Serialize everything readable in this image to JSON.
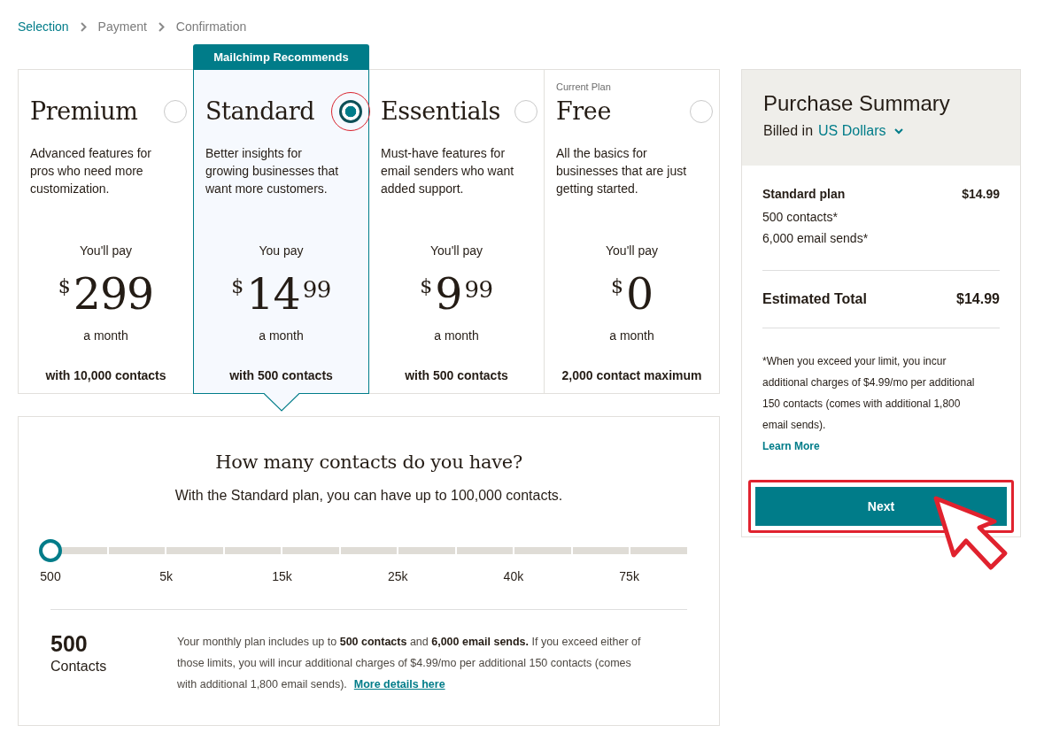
{
  "breadcrumb": [
    {
      "label": "Selection",
      "selected": true
    },
    {
      "label": "Payment",
      "selected": false
    },
    {
      "label": "Confirmation",
      "selected": false
    }
  ],
  "plans": [
    {
      "name": "Premium",
      "description": "Advanced features for pros who need more customization.",
      "pay_label": "You'll pay",
      "currency": "$",
      "amount": "299",
      "period": "a month",
      "contacts": "with 10,000 contacts",
      "selected": false,
      "circled": false
    },
    {
      "banner": "Mailchimp Recommends",
      "name": "Standard",
      "description": "Better insights for growing businesses that want more customers.",
      "pay_label": "You pay",
      "currency": "$",
      "amount": "14",
      "cents": "99",
      "period": "a month",
      "contacts": "with 500 contacts",
      "selected": true,
      "circled": true
    },
    {
      "name": "Essentials",
      "description": "Must-have features for email senders who want added support.",
      "pay_label": "You'll pay",
      "currency": "$",
      "amount": "9",
      "cents": "99",
      "period": "a month",
      "contacts": "with 500 contacts",
      "selected": false,
      "circled": false
    },
    {
      "note": "Current Plan",
      "name": "Free",
      "description": "All the basics for businesses that are just getting started.",
      "pay_label": "You'll pay",
      "currency": "$",
      "amount": "0",
      "period": "a month",
      "contacts": "2,000 contact maximum",
      "selected": false,
      "circled": false
    }
  ],
  "contacts": {
    "title": "How many contacts do you have?",
    "subtitle": "With the Standard plan, you can have up to 100,000 contacts.",
    "slider": {
      "level": 0,
      "ticks": [
        "500",
        "5k",
        "15k",
        "25k",
        "40k",
        "75k"
      ]
    },
    "count": "500",
    "count_label": "Contacts",
    "details": "Your monthly plan includes up to **500 contacts** and **6,000 email sends.** If you exceed either of those limits, you will incur additional charges of $4.99/mo per additional 150 contacts (comes with additional 1,800 email sends).",
    "details_link": "More details here"
  },
  "summary": {
    "title": "Purchase Summary",
    "billed_label": "Billed in",
    "currency": "US Dollars",
    "items": [
      {
        "label": "Standard plan",
        "price": "$14.99"
      }
    ],
    "lines": [
      "500 contacts*",
      "6,000 email sends*"
    ],
    "total_label": "Estimated Total",
    "total": "$14.99",
    "footnote": "*When you exceed your limit, you incur additional charges of $4.99/mo per additional 150 contacts (comes with additional 1,800 email sends).",
    "link": "Learn More",
    "next_button": {
      "label": "Next",
      "framed": true,
      "cursor": true
    }
  }
}
